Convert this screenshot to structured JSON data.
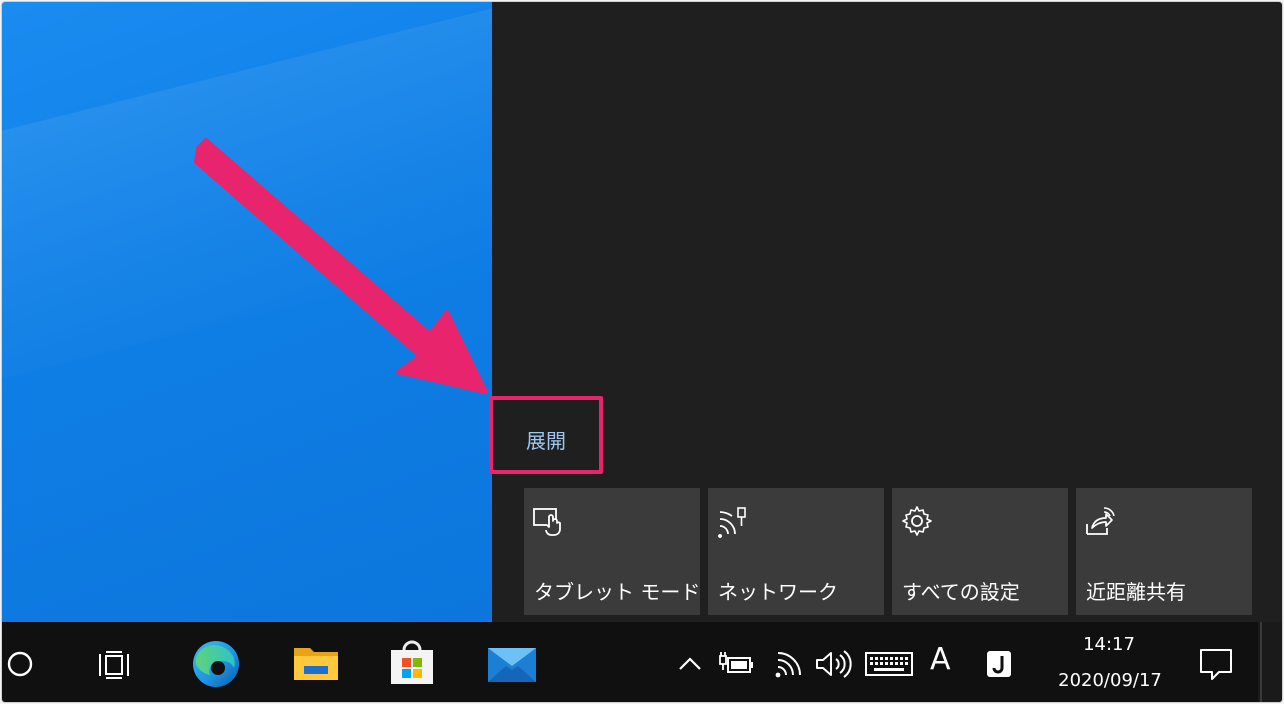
{
  "action_center": {
    "expand_label": "展開",
    "tiles": [
      {
        "label": "タブレット モード",
        "icon": "tablet-mode-icon"
      },
      {
        "label": "ネットワーク",
        "icon": "network-icon"
      },
      {
        "label": "すべての設定",
        "icon": "gear-icon"
      },
      {
        "label": "近距離共有",
        "icon": "nearby-share-icon"
      }
    ]
  },
  "taskbar": {
    "ime_mode": "A",
    "time": "14:17",
    "date": "2020/09/17"
  },
  "colors": {
    "highlight": "#e8246d",
    "expand_link": "#9ec8ef",
    "tile_bg": "#3b3b3b",
    "panel_bg": "#1f1f1f",
    "taskbar_bg": "#101010"
  }
}
